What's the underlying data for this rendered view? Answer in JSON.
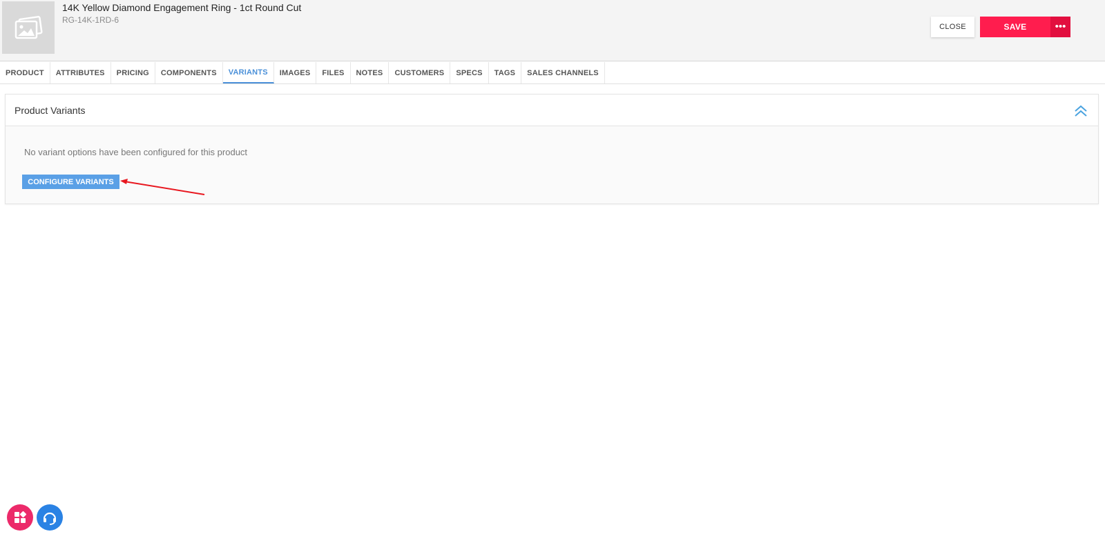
{
  "product": {
    "title": "14K Yellow Diamond Engagement Ring - 1ct Round Cut",
    "sku": "RG-14K-1RD-6",
    "thumbnail_icon": "image-placeholder-icon"
  },
  "actions": {
    "close_label": "CLOSE",
    "save_label": "SAVE",
    "more_label": "•••"
  },
  "tabs": [
    {
      "label": "PRODUCT",
      "active": false
    },
    {
      "label": "ATTRIBUTES",
      "active": false
    },
    {
      "label": "PRICING",
      "active": false
    },
    {
      "label": "COMPONENTS",
      "active": false
    },
    {
      "label": "VARIANTS",
      "active": true
    },
    {
      "label": "IMAGES",
      "active": false
    },
    {
      "label": "FILES",
      "active": false
    },
    {
      "label": "NOTES",
      "active": false
    },
    {
      "label": "CUSTOMERS",
      "active": false
    },
    {
      "label": "SPECS",
      "active": false
    },
    {
      "label": "TAGS",
      "active": false
    },
    {
      "label": "SALES CHANNELS",
      "active": false
    }
  ],
  "panel": {
    "title": "Product Variants",
    "empty_message": "No variant options have been configured for this product",
    "configure_label": "CONFIGURE VARIANTS"
  },
  "colors": {
    "accent": "#4a90d9",
    "save": "#ff1d4e",
    "configure": "#5aa0e6",
    "annotation_arrow": "#e8171f"
  }
}
